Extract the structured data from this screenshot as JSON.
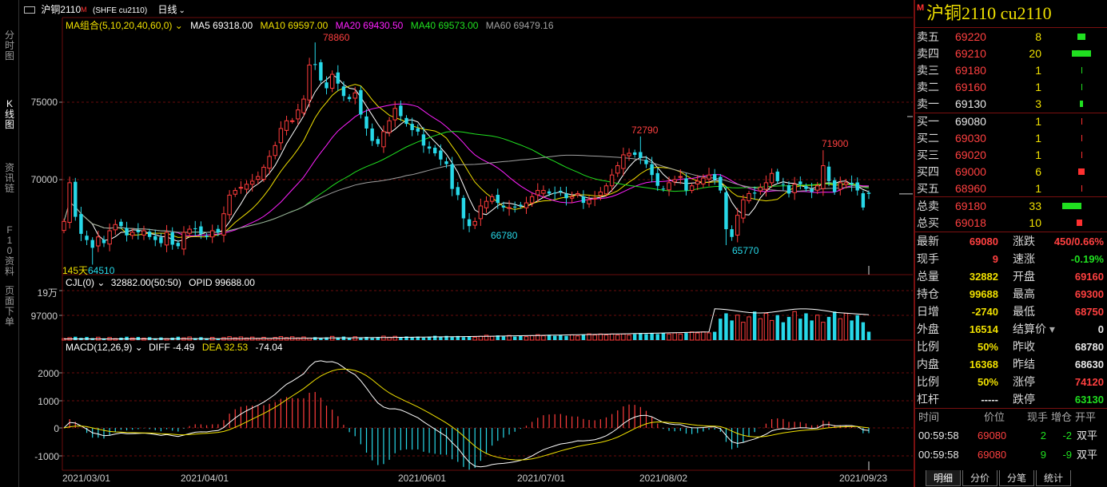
{
  "toolbar": {
    "symbol": "沪铜2110",
    "symbol_mark": "M",
    "exchange_code": "(SHFE cu2110)",
    "period": "日线",
    "dropdown_glyph": "⌄"
  },
  "left_tabs": [
    "分时图",
    "K线图",
    "资讯链",
    "F10资料",
    "页面下单"
  ],
  "ma_legend": {
    "group": "MA组合(5,10,20,40,60,0)",
    "ma5": "MA5 69318.00",
    "ma10": "MA10 69597.00",
    "ma20": "MA20 69430.50",
    "ma40": "MA40 69573.00",
    "ma60": "MA60 69479.16"
  },
  "price_axis": [
    "75000",
    "70000"
  ],
  "annotations": {
    "high1": "78860",
    "high2": "72790",
    "high3": "71900",
    "low1": "66780",
    "low2": "65770",
    "low0": "64510",
    "days": "145天"
  },
  "vol_legend": {
    "name": "CJL(0)",
    "values": "32882.00(50:50)",
    "opid": "OPID 99688.00"
  },
  "vol_axis": [
    "19万",
    "97000"
  ],
  "macd_legend": {
    "name": "MACD(12,26,9)",
    "diff": "DIFF -4.49",
    "dea": "DEA 32.53",
    "macd": "-74.04"
  },
  "macd_axis": [
    "2000",
    "1000",
    "0",
    "-1000"
  ],
  "dates": [
    "2021/03/01",
    "2021/04/01",
    "2021/06/01",
    "2021/07/01",
    "2021/08/02",
    "2021/09/23"
  ],
  "panel": {
    "title": "沪铜2110  cu2110",
    "title_mark": "M",
    "asks": [
      {
        "label": "卖五",
        "price": "69220",
        "vol": "8"
      },
      {
        "label": "卖四",
        "price": "69210",
        "vol": "20"
      },
      {
        "label": "卖三",
        "price": "69180",
        "vol": "1"
      },
      {
        "label": "卖二",
        "price": "69160",
        "vol": "1"
      },
      {
        "label": "卖一",
        "price": "69130",
        "vol": "3"
      }
    ],
    "bids": [
      {
        "label": "买一",
        "price": "69080",
        "vol": "1"
      },
      {
        "label": "买二",
        "price": "69030",
        "vol": "1"
      },
      {
        "label": "买三",
        "price": "69020",
        "vol": "1"
      },
      {
        "label": "买四",
        "price": "69000",
        "vol": "6"
      },
      {
        "label": "买五",
        "price": "68960",
        "vol": "1"
      }
    ],
    "totals": [
      {
        "label": "总卖",
        "price": "69180",
        "vol": "33"
      },
      {
        "label": "总买",
        "price": "69018",
        "vol": "10"
      }
    ],
    "quotes": [
      {
        "l1": "最新",
        "v1": "69080",
        "l2": "涨跌",
        "v2": "450/0.66%"
      },
      {
        "l1": "现手",
        "v1": "9",
        "l2": "速涨",
        "v2": "-0.19%"
      },
      {
        "l1": "总量",
        "v1": "32882",
        "l2": "开盘",
        "v2": "69160"
      },
      {
        "l1": "持仓",
        "v1": "99688",
        "l2": "最高",
        "v2": "69300"
      },
      {
        "l1": "日增",
        "v1": "-2740",
        "l2": "最低",
        "v2": "68750"
      },
      {
        "l1": "外盘",
        "v1": "16514",
        "l2": "结算价",
        "v2": "0"
      },
      {
        "l1": "比例",
        "v1": "50%",
        "l2": "昨收",
        "v2": "68780"
      },
      {
        "l1": "内盘",
        "v1": "16368",
        "l2": "昨结",
        "v2": "68630"
      },
      {
        "l1": "比例",
        "v1": "50%",
        "l2": "涨停",
        "v2": "74120"
      },
      {
        "l1": "杠杆",
        "v1": "-----",
        "l2": "跌停",
        "v2": "63130"
      }
    ],
    "settle_dropdown": "▾",
    "ticks_header": {
      "time": "时间",
      "price": "价位",
      "hand": "现手",
      "oi": "增仓",
      "type": "开平"
    },
    "ticks": [
      {
        "time": "00:59:58",
        "price": "69080",
        "hand": "2",
        "oi": "-2",
        "type": "双平"
      },
      {
        "time": "00:59:58",
        "price": "69080",
        "hand": "9",
        "oi": "-9",
        "type": "双平"
      }
    ]
  },
  "bottom_tabs": [
    "明细",
    "分价",
    "分笔",
    "统计"
  ],
  "colors": {
    "up": "#ff3c3c",
    "down": "#27d8e8",
    "ma5": "#ffffff",
    "ma10": "#f0e000",
    "ma20": "#ff20ff",
    "ma40": "#20e020",
    "ma60": "#a0a0a0",
    "grid": "#6a0c0c"
  },
  "chart_data": {
    "type": "candlestick",
    "title": "沪铜2110 日线",
    "annotated_highs": [
      78860,
      72790,
      71900
    ],
    "annotated_lows": [
      64510,
      66780,
      65770
    ],
    "last": {
      "open": 69160,
      "high": 69300,
      "low": 68750,
      "close": 69080
    },
    "ylim_hint": [
      64000,
      80000
    ],
    "closes": [
      67300,
      69800,
      67600,
      66500,
      66100,
      65600,
      66300,
      65900,
      66700,
      67100,
      67000,
      66400,
      66600,
      66600,
      66700,
      66300,
      66100,
      65900,
      66600,
      65800,
      65700,
      66600,
      66800,
      66800,
      66500,
      66300,
      66700,
      66600,
      67800,
      69000,
      69300,
      69500,
      69700,
      69900,
      70200,
      70800,
      71500,
      72200,
      73300,
      73800,
      73800,
      74500,
      75200,
      77400,
      77400,
      76400,
      75900,
      76800,
      76200,
      75400,
      75200,
      75600,
      74200,
      73300,
      72500,
      72300,
      73100,
      73800,
      74600,
      74100,
      73600,
      73200,
      73100,
      72200,
      72000,
      71700,
      71300,
      71000,
      69400,
      69000,
      67500,
      67000,
      67300,
      68300,
      68600,
      68900,
      68500,
      68200,
      68200,
      68200,
      68300,
      68500,
      68900,
      69300,
      69300,
      69100,
      69100,
      69200,
      68800,
      68900,
      69100,
      68500,
      68700,
      68800,
      69200,
      69600,
      70300,
      70900,
      71600,
      71700,
      71600,
      71400,
      71000,
      70300,
      69600,
      69400,
      69800,
      70000,
      70200,
      69300,
      69600,
      69900,
      70100,
      70300,
      70000,
      69300,
      66800,
      66300,
      67700,
      68700,
      69100,
      69100,
      69500,
      69800,
      70400,
      69900,
      69700,
      69100,
      69700,
      69700,
      69400,
      69200,
      69600,
      70900,
      69900,
      69200,
      69800,
      69800,
      69700,
      69300,
      68200,
      69080
    ],
    "volume_oi_hint": "CJL 32882, OPID 99688",
    "macd": {
      "diff": -4.49,
      "dea": 32.53,
      "macd": -74.04
    }
  }
}
